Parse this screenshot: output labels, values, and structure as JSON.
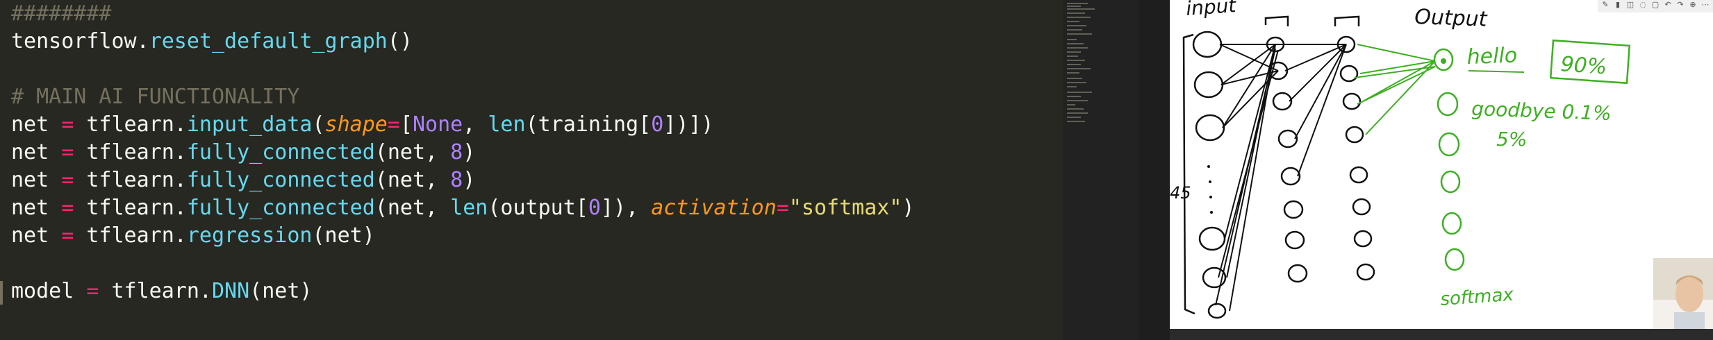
{
  "editor": {
    "lines": [
      {
        "segments": [
          {
            "cls": "cm",
            "text": "########"
          }
        ]
      },
      {
        "segments": [
          {
            "cls": "",
            "text": "tensorflow."
          },
          {
            "cls": "fn",
            "text": "reset_default_graph"
          },
          {
            "cls": "",
            "text": "()"
          }
        ]
      },
      {
        "segments": [
          {
            "cls": "",
            "text": ""
          }
        ]
      },
      {
        "segments": [
          {
            "cls": "cm",
            "text": "# MAIN AI FUNCTIONALITY"
          }
        ]
      },
      {
        "segments": [
          {
            "cls": "",
            "text": "net "
          },
          {
            "cls": "op",
            "text": "="
          },
          {
            "cls": "",
            "text": " tflearn."
          },
          {
            "cls": "fn",
            "text": "input_data"
          },
          {
            "cls": "",
            "text": "("
          },
          {
            "cls": "kw",
            "text": "shape"
          },
          {
            "cls": "op",
            "text": "="
          },
          {
            "cls": "",
            "text": "["
          },
          {
            "cls": "num",
            "text": "None"
          },
          {
            "cls": "",
            "text": ", "
          },
          {
            "cls": "fn",
            "text": "len"
          },
          {
            "cls": "",
            "text": "(training["
          },
          {
            "cls": "num",
            "text": "0"
          },
          {
            "cls": "",
            "text": "])])"
          }
        ]
      },
      {
        "segments": [
          {
            "cls": "",
            "text": "net "
          },
          {
            "cls": "op",
            "text": "="
          },
          {
            "cls": "",
            "text": " tflearn."
          },
          {
            "cls": "fn",
            "text": "fully_connected"
          },
          {
            "cls": "",
            "text": "(net, "
          },
          {
            "cls": "num",
            "text": "8"
          },
          {
            "cls": "",
            "text": ")"
          }
        ]
      },
      {
        "segments": [
          {
            "cls": "",
            "text": "net "
          },
          {
            "cls": "op",
            "text": "="
          },
          {
            "cls": "",
            "text": " tflearn."
          },
          {
            "cls": "fn",
            "text": "fully_connected"
          },
          {
            "cls": "",
            "text": "(net, "
          },
          {
            "cls": "num",
            "text": "8"
          },
          {
            "cls": "",
            "text": ")"
          }
        ]
      },
      {
        "segments": [
          {
            "cls": "",
            "text": "net "
          },
          {
            "cls": "op",
            "text": "="
          },
          {
            "cls": "",
            "text": " tflearn."
          },
          {
            "cls": "fn",
            "text": "fully_connected"
          },
          {
            "cls": "",
            "text": "(net, "
          },
          {
            "cls": "fn",
            "text": "len"
          },
          {
            "cls": "",
            "text": "(output["
          },
          {
            "cls": "num",
            "text": "0"
          },
          {
            "cls": "",
            "text": "]), "
          },
          {
            "cls": "kw",
            "text": "activation"
          },
          {
            "cls": "op",
            "text": "="
          },
          {
            "cls": "str",
            "text": "\"softmax\""
          },
          {
            "cls": "",
            "text": ")"
          }
        ]
      },
      {
        "segments": [
          {
            "cls": "",
            "text": "net "
          },
          {
            "cls": "op",
            "text": "="
          },
          {
            "cls": "",
            "text": " tflearn."
          },
          {
            "cls": "fn",
            "text": "regression"
          },
          {
            "cls": "",
            "text": "(net)"
          }
        ]
      },
      {
        "segments": [
          {
            "cls": "",
            "text": ""
          }
        ]
      },
      {
        "segments": [
          {
            "cls": "",
            "text": "model "
          },
          {
            "cls": "op",
            "text": "="
          },
          {
            "cls": "",
            "text": " tflearn."
          },
          {
            "cls": "fn",
            "text": "DNN"
          },
          {
            "cls": "",
            "text": "(net)"
          }
        ]
      }
    ]
  },
  "whiteboard": {
    "labels": {
      "input": "input",
      "output": "Output",
      "count": "45",
      "hello": "hello",
      "percent_hello": "90%",
      "goodbye": "goodbye 0.1%",
      "other": "5%",
      "softmax": "softmax"
    },
    "colors": {
      "ink": "#111111",
      "green": "#3cb021"
    },
    "toolbar_icons": [
      "pen-icon",
      "highlighter-icon",
      "eraser-icon",
      "lasso-icon",
      "shape-icon",
      "undo-icon",
      "redo-icon",
      "zoom-icon",
      "more-icon"
    ]
  }
}
